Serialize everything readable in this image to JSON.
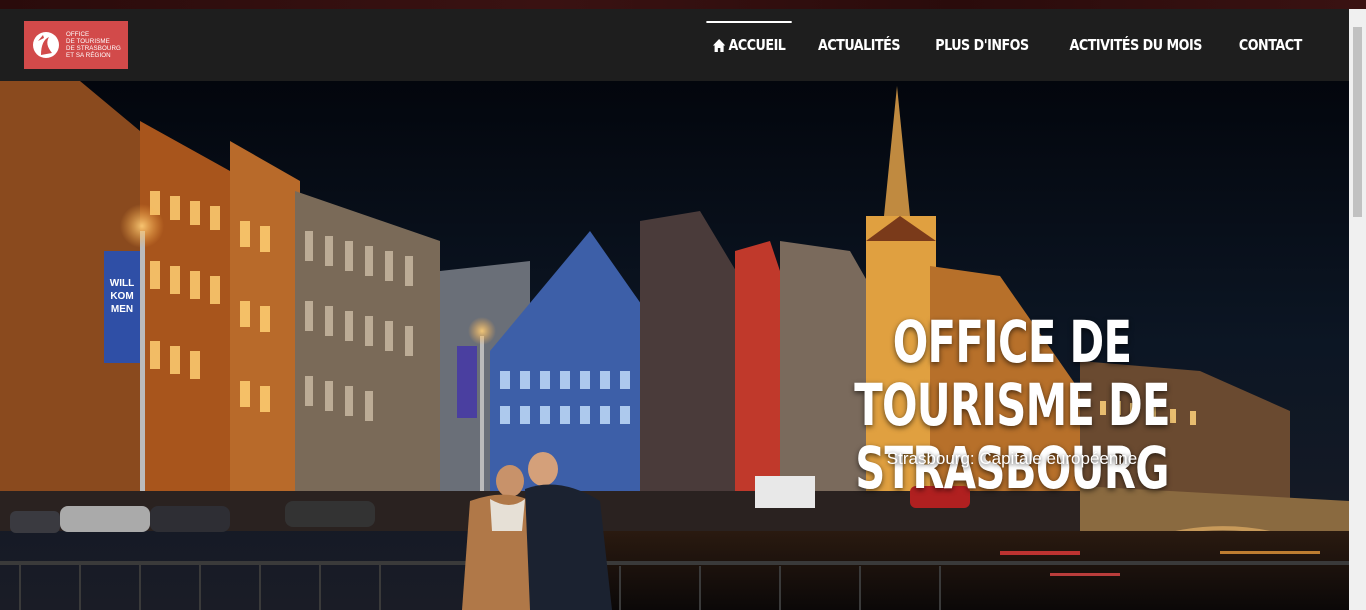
{
  "logo": {
    "lines": [
      "OFFICE",
      "DE TOURISME",
      "DE STRASBOURG",
      "ET SA RÉGION"
    ],
    "color": "#d24a4a"
  },
  "nav": {
    "items": [
      {
        "label": "ACCUEIL",
        "icon": "home-icon",
        "active": true
      },
      {
        "label": "ACTUALITÉS"
      },
      {
        "label": "PLUS D'INFOS"
      },
      {
        "label": "ACTIVITÉS DU MOIS"
      },
      {
        "label": "CONTACT"
      }
    ]
  },
  "hero": {
    "title_line1": "OFFICE DE TOURISME DE",
    "title_line2": "STRASBOURG",
    "subtitle": "Strasbourg: Capitale européenne",
    "banner_text": "WILL KOM MEN"
  }
}
